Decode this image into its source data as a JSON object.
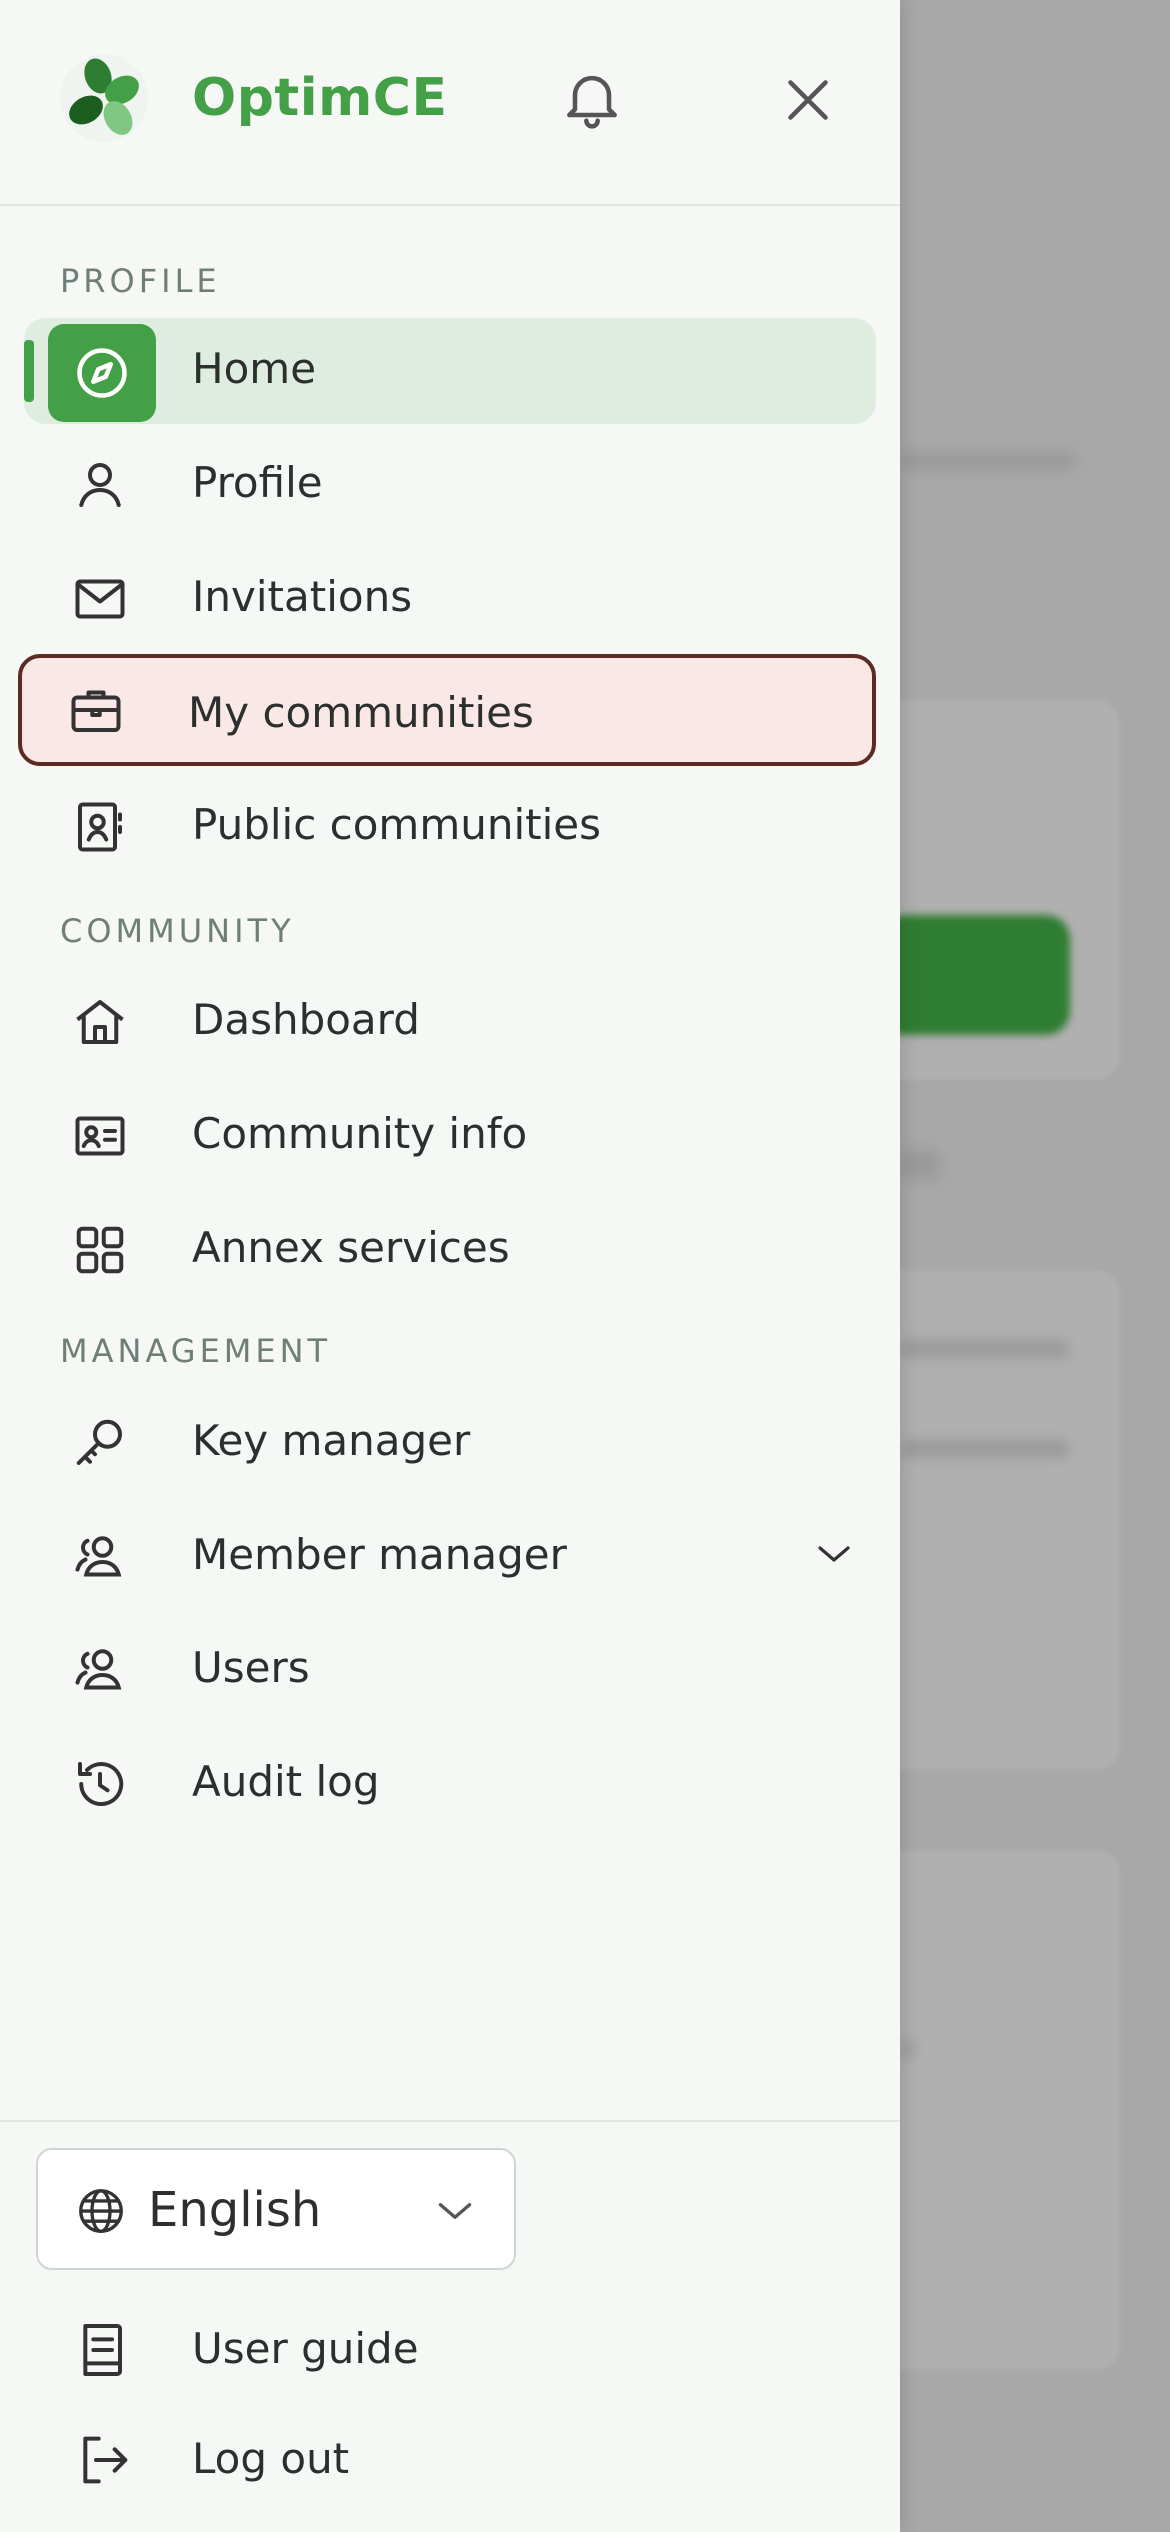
{
  "app": {
    "brand": "OptimCE"
  },
  "sections": {
    "profile": "PROFILE",
    "community": "COMMUNITY",
    "management": "MANAGEMENT"
  },
  "nav": {
    "home": "Home",
    "profile": "Profile",
    "invitations": "Invitations",
    "my_communities": "My communities",
    "public_communities": "Public communities",
    "dashboard": "Dashboard",
    "community_info": "Community info",
    "annex_services": "Annex services",
    "key_manager": "Key manager",
    "member_manager": "Member manager",
    "users": "Users",
    "audit_log": "Audit log"
  },
  "footer": {
    "language": "English",
    "user_guide": "User guide",
    "log_out": "Log out"
  },
  "colors": {
    "accent": "#43a047",
    "active_bg": "#dfede0",
    "highlight_bg": "#f9e8e6",
    "highlight_border": "#5d2b24"
  },
  "icons": {
    "logo": "clover-logo-icon",
    "notifications": "bell-icon",
    "close": "close-icon"
  }
}
